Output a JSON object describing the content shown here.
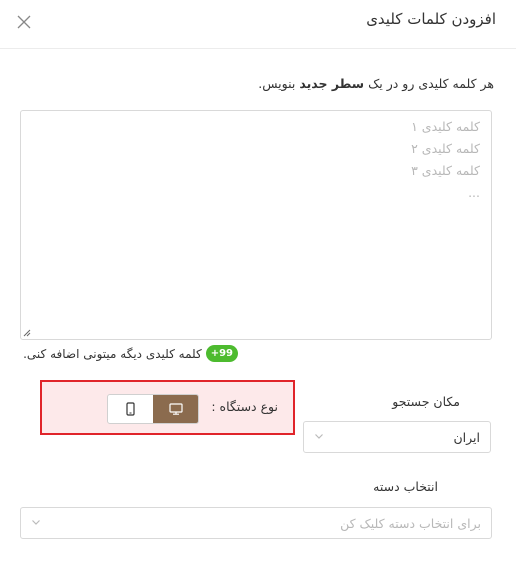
{
  "dialog": {
    "title": "افزودن کلمات کلیدی"
  },
  "instructions": {
    "prefix": "هر کلمه کلیدی رو در یک ",
    "bold": "سطر جدید",
    "suffix": " بنویس."
  },
  "keywords_input": {
    "value": "",
    "placeholder_lines": [
      "کلمه کلیدی ۱",
      "کلمه کلیدی ۲",
      "کلمه کلیدی ۳",
      "..."
    ]
  },
  "remaining": {
    "badge": "+99",
    "text": "کلمه کلیدی دیگه میتونی اضافه کنی."
  },
  "device": {
    "label": "نوع دستگاه :",
    "selected": "desktop",
    "options": [
      {
        "id": "desktop",
        "icon": "desktop-icon"
      },
      {
        "id": "mobile",
        "icon": "mobile-icon"
      }
    ]
  },
  "location": {
    "label": "مکان جستجو",
    "selected": "ایران"
  },
  "group": {
    "label": "انتخاب دسته",
    "placeholder": "برای انتخاب دسته کلیک کن"
  },
  "colors": {
    "accent": "#8b6b4e",
    "badge": "#4dbb2f",
    "highlight_border": "#e0242a",
    "highlight_bg": "#fde9ea"
  }
}
